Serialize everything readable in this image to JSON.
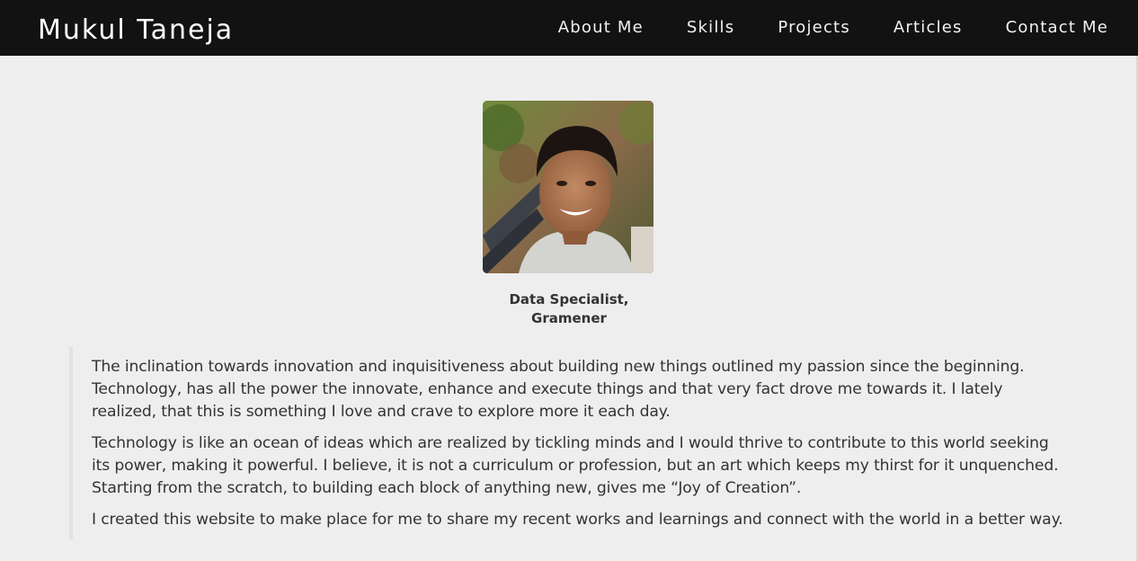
{
  "header": {
    "brand": "Mukul Taneja",
    "nav": [
      {
        "label": "About Me"
      },
      {
        "label": "Skills"
      },
      {
        "label": "Projects"
      },
      {
        "label": "Articles"
      },
      {
        "label": "Contact Me"
      }
    ]
  },
  "profile": {
    "role_line1": "Data Specialist,",
    "role_line2": "Gramener"
  },
  "about": {
    "paragraphs": [
      "The inclination towards innovation and inquisitiveness about building new things outlined my passion since the beginning. Technology, has all the power the innovate, enhance and execute things and that very fact drove me towards it. I lately realized, that this is something I love and crave to explore more it each day.",
      "Technology is like an ocean of ideas which are realized by tickling minds and I would thrive to contribute to this world seeking its power, making it powerful. I believe, it is not a curriculum or profession, but an art which keeps my thirst for it unquenched. Starting from the scratch, to building each block of anything new, gives me “Joy of Creation”.",
      "I created this website to make place for me to share my recent works and learnings and connect with the world in a better way."
    ]
  }
}
